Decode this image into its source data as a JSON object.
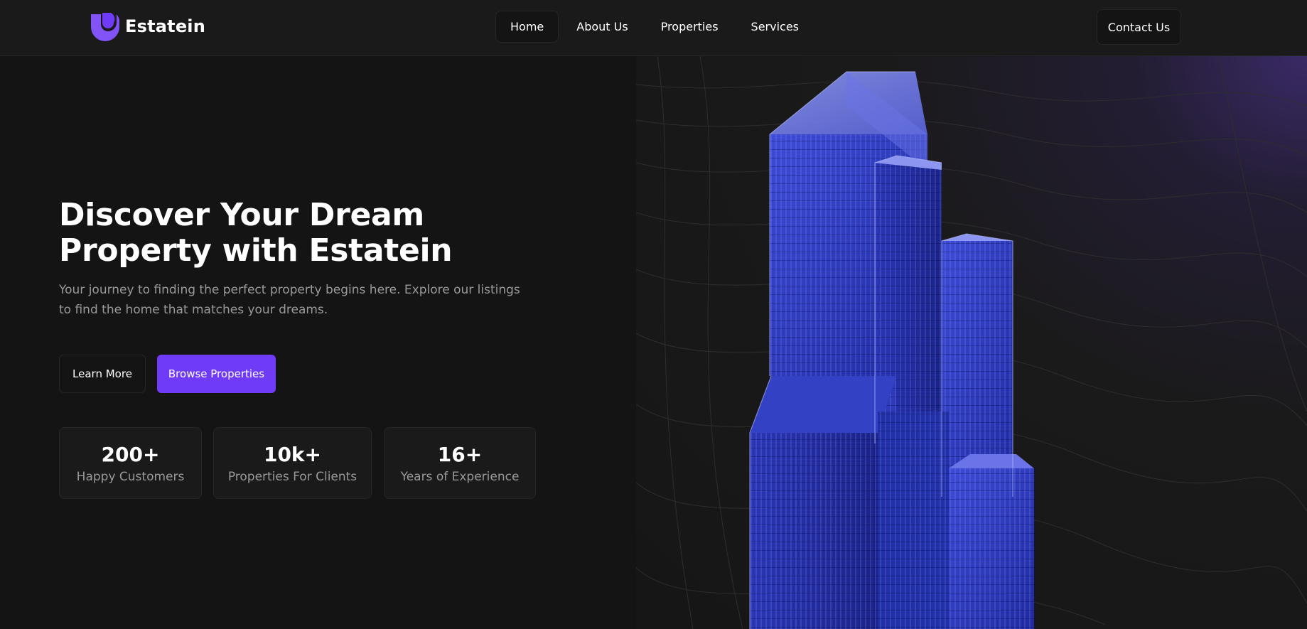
{
  "brand": {
    "name": "Estatein",
    "accent_color": "#703bf7",
    "logo_icon": "estatein-logo-icon"
  },
  "nav": {
    "items": [
      {
        "label": "Home",
        "active": true
      },
      {
        "label": "About Us",
        "active": false
      },
      {
        "label": "Properties",
        "active": false
      },
      {
        "label": "Services",
        "active": false
      }
    ],
    "contact_label": "Contact Us"
  },
  "hero": {
    "title_line1": "Discover Your Dream",
    "title_line2": "Property with Estatein",
    "subtitle": "Your journey to finding the perfect property begins here. Explore our listings to find the home that matches your dreams.",
    "learn_more_label": "Learn More",
    "browse_label": "Browse Properties",
    "stats": [
      {
        "value": "200+",
        "label": "Happy Customers"
      },
      {
        "value": "10k+",
        "label": "Properties For Clients"
      },
      {
        "value": "16+",
        "label": "Years of Experience"
      }
    ]
  },
  "image": {
    "subject": "blue-glass-skyscraper"
  }
}
